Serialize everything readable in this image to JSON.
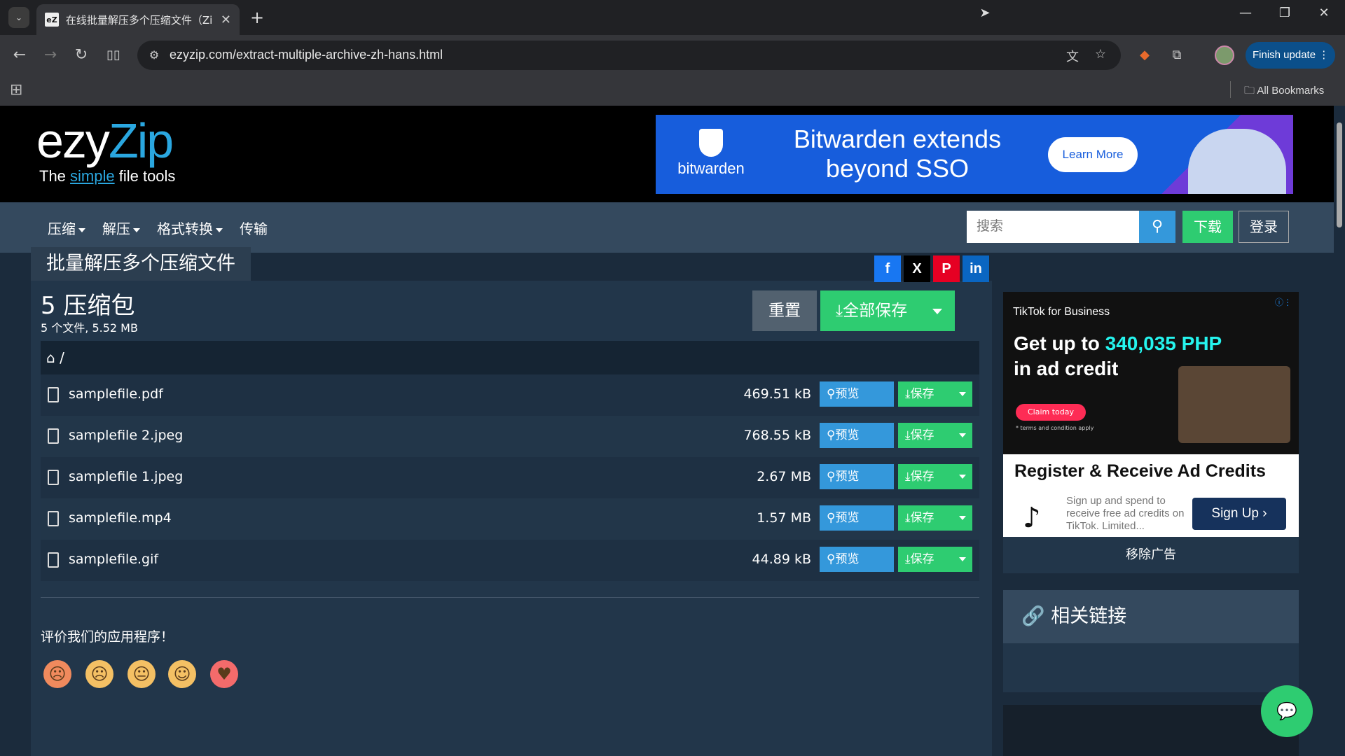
{
  "browser": {
    "tab_title": "在线批量解压多个压缩文件（Zi",
    "favicon": "eZ",
    "url": "ezyzip.com/extract-multiple-archive-zh-hans.html",
    "finish_update": "Finish update",
    "all_bookmarks": "All Bookmarks"
  },
  "site": {
    "logo_prefix": "ezy",
    "logo_suffix": "Zip",
    "tagline_pre": "The ",
    "tagline_mid": "simple",
    "tagline_post": " file tools"
  },
  "top_ad": {
    "brand": "bitwarden",
    "headline": "Bitwarden extends beyond SSO",
    "cta": "Learn More"
  },
  "nav": {
    "items": [
      {
        "label": "压缩",
        "dropdown": true
      },
      {
        "label": "解压",
        "dropdown": true
      },
      {
        "label": "格式转换",
        "dropdown": true
      },
      {
        "label": "传输",
        "dropdown": false
      }
    ],
    "search_placeholder": "搜索",
    "download": "下载",
    "login": "登录"
  },
  "panel": {
    "title": "批量解压多个压缩文件",
    "count_title": "5 压缩包",
    "count_sub": "5 个文件, 5.52 MB",
    "reset": "重置",
    "save_all": "全部保存",
    "path": "/",
    "preview_label": "预览",
    "save_label": "保存",
    "files": [
      {
        "name": "samplefile.pdf",
        "size": "469.51 kB"
      },
      {
        "name": "samplefile 2.jpeg",
        "size": "768.55 kB"
      },
      {
        "name": "samplefile 1.jpeg",
        "size": "2.67 MB"
      },
      {
        "name": "samplefile.mp4",
        "size": "1.57 MB"
      },
      {
        "name": "samplefile.gif",
        "size": "44.89 kB"
      }
    ],
    "rate_label": "评价我们的应用程序！",
    "share": [
      "f",
      "X",
      "P",
      "in"
    ]
  },
  "side_ad": {
    "brand": "TikTok for Business",
    "headline_pre": "Get up to ",
    "headline_amount": "340,035 PHP",
    "headline_post": "in ad credit",
    "claim": "Claim today",
    "terms": "* terms and condition apply",
    "register": "Register & Receive Ad Credits",
    "desc": "Sign up and spend to receive free ad credits on TikTok. Limited...",
    "signup": "Sign Up"
  },
  "sidebar": {
    "remove_ads": "移除广告",
    "related_title": "相关链接"
  },
  "colors": {
    "page_bg": "#1b2b3c",
    "nav_bg": "#34495e",
    "accent_blue": "#3498db",
    "accent_green": "#2ecc71"
  }
}
